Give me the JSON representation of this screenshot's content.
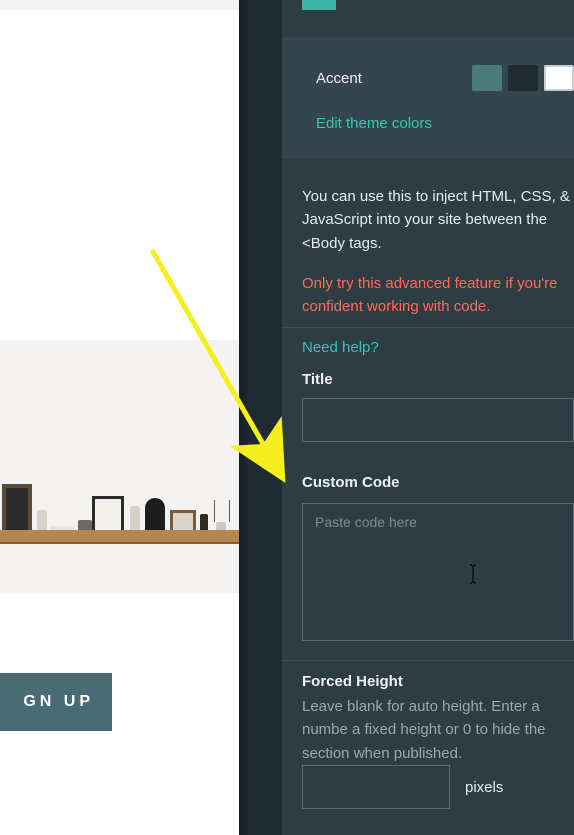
{
  "preview": {
    "signup_label": "GN UP"
  },
  "panel": {
    "accent_label": "Accent",
    "edit_colors": "Edit theme colors",
    "swatches": [
      "#4a7a7a",
      "#1f2b30",
      "#ffffff"
    ],
    "description": "You can use this to inject HTML, CSS, & JavaScript into your site between the <Body tags.",
    "warning": "Only try this advanced feature if you're confident working with code.",
    "help": "Need help?",
    "title_label": "Title",
    "title_value": "",
    "code_label": "Custom Code",
    "code_placeholder": "Paste code here",
    "code_value": "",
    "height_label": "Forced Height",
    "height_desc": "Leave blank for auto height. Enter a numbe a fixed height or 0 to hide the section when published.",
    "height_value": "",
    "pixels": "pixels"
  }
}
